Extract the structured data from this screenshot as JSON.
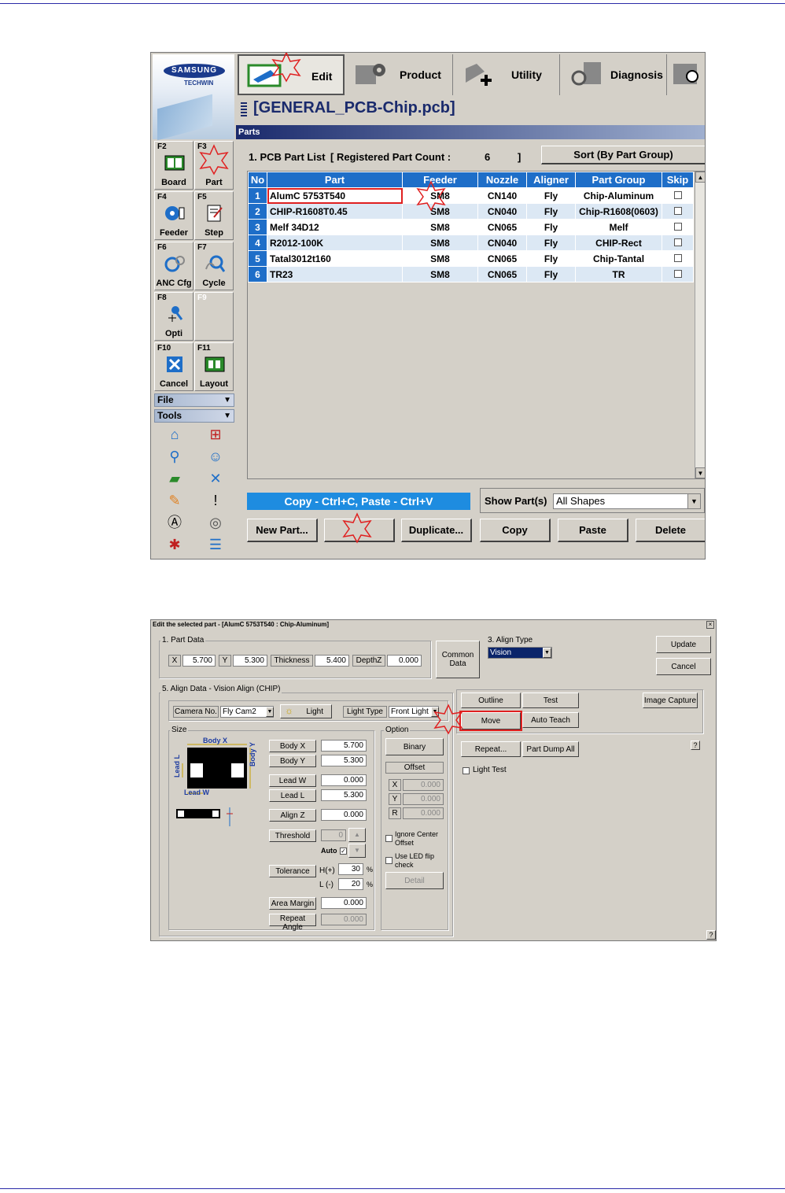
{
  "main": {
    "logo": {
      "brand": "SAMSUNG",
      "sub": "TECHWIN"
    },
    "toolbar": [
      {
        "label": "Edit"
      },
      {
        "label": "Product"
      },
      {
        "label": "Utility"
      },
      {
        "label": "Diagnosis"
      }
    ],
    "fkeys": [
      {
        "key": "F2",
        "label": "Board",
        "icon": "board-icon"
      },
      {
        "key": "F3",
        "label": "Part",
        "icon": "part-icon"
      },
      {
        "key": "F4",
        "label": "Feeder",
        "icon": "feeder-icon"
      },
      {
        "key": "F5",
        "label": "Step",
        "icon": "step-icon"
      },
      {
        "key": "F6",
        "label": "ANC Cfg",
        "icon": "anc-cfg-icon"
      },
      {
        "key": "F7",
        "label": "Cycle",
        "icon": "cycle-icon"
      },
      {
        "key": "F8",
        "label": "Opti",
        "icon": "opti-icon"
      },
      {
        "key": "F9",
        "label": "",
        "icon": ""
      },
      {
        "key": "F10",
        "label": "Cancel",
        "icon": "cancel-icon"
      },
      {
        "key": "F11",
        "label": "Layout",
        "icon": "layout-icon"
      }
    ],
    "menus": {
      "file": "File",
      "tools": "Tools"
    },
    "file_title": "[GENERAL_PCB-Chip.pcb]",
    "section": "Parts",
    "list_label": "1. PCB Part List",
    "reg_label": "[ Registered Part Count :",
    "reg_count": "6",
    "reg_close": "]",
    "sort_button": "Sort (By Part Group)",
    "columns": [
      "No",
      "Part",
      "Feeder",
      "Nozzle",
      "Aligner",
      "Part Group",
      "Skip"
    ],
    "rows": [
      {
        "no": "1",
        "part": "AlumC 5753T540",
        "feeder": "SM8",
        "nozzle": "CN140",
        "aligner": "Fly",
        "group": "Chip-Aluminum"
      },
      {
        "no": "2",
        "part": "CHIP-R1608T0.45",
        "feeder": "SM8",
        "nozzle": "CN040",
        "aligner": "Fly",
        "group": "Chip-R1608(0603)"
      },
      {
        "no": "3",
        "part": "Melf 34D12",
        "feeder": "SM8",
        "nozzle": "CN065",
        "aligner": "Fly",
        "group": "Melf"
      },
      {
        "no": "4",
        "part": "R2012-100K",
        "feeder": "SM8",
        "nozzle": "CN040",
        "aligner": "Fly",
        "group": "CHIP-Rect"
      },
      {
        "no": "5",
        "part": "Tatal3012t160",
        "feeder": "SM8",
        "nozzle": "CN065",
        "aligner": "Fly",
        "group": "Chip-Tantal"
      },
      {
        "no": "6",
        "part": "TR23",
        "feeder": "SM8",
        "nozzle": "CN065",
        "aligner": "Fly",
        "group": "TR"
      }
    ],
    "copy_hint": "Copy - Ctrl+C,  Paste - Ctrl+V",
    "show_label": "Show Part(s)",
    "show_value": "All Shapes",
    "buttons": {
      "new_part": "New Part...",
      "edit": "",
      "duplicate": "Duplicate...",
      "copy": "Copy",
      "paste": "Paste",
      "delete": "Delete"
    }
  },
  "dialog": {
    "title": "Edit the selected part - [AlumC 5753T540 : Chip-Aluminum]",
    "part_data_label": "1. Part Data",
    "x_label": "X",
    "x_value": "5.700",
    "y_label": "Y",
    "y_value": "5.300",
    "thickness_label": "Thickness",
    "thickness_value": "5.400",
    "depthz_label": "DepthZ",
    "depthz_value": "0.000",
    "common_data": "Common Data",
    "align_type_label": "3. Align Type",
    "align_type_value": "Vision",
    "update": "Update",
    "cancel": "Cancel",
    "align_data_label": "5. Align Data - Vision Align (CHIP)",
    "camera_label": "Camera No.",
    "camera_value": "Fly Cam2",
    "light": "Light",
    "light_type_label": "Light Type",
    "light_type_value": "Front Light",
    "size_label": "Size",
    "diagram": {
      "body_x": "Body X",
      "body_y": "Body Y",
      "lead_l": "Lead L",
      "lead_w": "Lead W"
    },
    "body_x_label": "Body X",
    "body_x_value": "5.700",
    "body_y_label": "Body Y",
    "body_y_value": "5.300",
    "lead_w_label": "Lead W",
    "lead_w_value": "0.000",
    "lead_l_label": "Lead L",
    "lead_l_value": "5.300",
    "align_z_label": "Align Z",
    "align_z_value": "0.000",
    "threshold_label": "Threshold",
    "threshold_value": "0",
    "auto_label": "Auto",
    "tolerance_label": "Tolerance",
    "h_label": "H(+)",
    "h_value": "30",
    "pct": "%",
    "l_label": "L (-)",
    "l_value": "20",
    "area_margin_label": "Area Margin",
    "area_margin_value": "0.000",
    "repeat_angle_label": "Repeat Angle",
    "repeat_angle_value": "0.000",
    "option_label": "Option",
    "binary": "Binary",
    "offset_label": "Offset",
    "ox": "X",
    "oy": "Y",
    "or": "R",
    "ox_value": "0.000",
    "oy_value": "0.000",
    "or_value": "0.000",
    "ignore_center": "Ignore Center Offset",
    "use_led": "Use LED flip check",
    "detail": "Detail",
    "outline": "Outline",
    "test": "Test",
    "move": "Move",
    "auto_teach": "Auto Teach",
    "image_capture": "Image Capture",
    "repeat": "Repeat...",
    "part_dump_all": "Part Dump All",
    "light_test": "Light Test",
    "help": "?"
  },
  "colors": {
    "grid_header": "#1e6ec8",
    "highlight": "#e02020",
    "row_alt": "#dce8f4"
  }
}
